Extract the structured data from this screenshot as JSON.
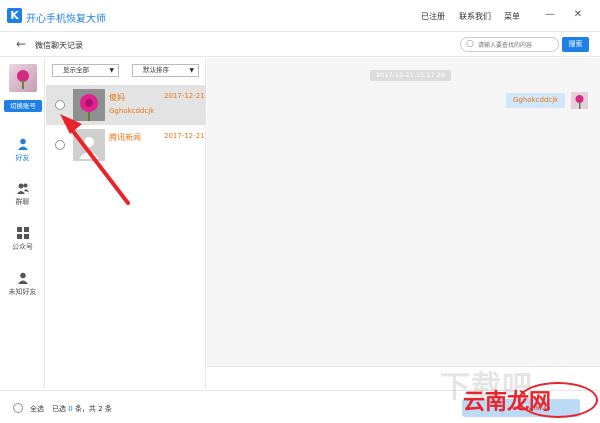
{
  "app": {
    "logo": "K",
    "title": "开心手机恢复大师"
  },
  "top_menu": {
    "register": "已注册",
    "contact": "联系我们",
    "menu": "菜单"
  },
  "window_controls": {
    "minimize": "—",
    "close": "✕"
  },
  "subbar": {
    "back": "←",
    "title": "微信聊天记录",
    "search_placeholder": "请输入要查找的内容",
    "search_button": "搜索"
  },
  "sidebar": {
    "switch_account": "切换账号",
    "nav": [
      {
        "label": "好友",
        "icon": "person-icon"
      },
      {
        "label": "群聊",
        "icon": "group-icon"
      },
      {
        "label": "公众号",
        "icon": "grid-icon"
      },
      {
        "label": "未知好友",
        "icon": "unknown-person-icon"
      }
    ]
  },
  "filters": {
    "show": "显示全部",
    "sort": "默认排序"
  },
  "contacts": [
    {
      "name": "傻妈",
      "date": "2017-12-21",
      "last_message": "Gghokcddcjk"
    },
    {
      "name": "腾讯新闻",
      "date": "2017-12-21",
      "last_message": ""
    }
  ],
  "chat": {
    "timestamp": "2017-12-21 15:17:26",
    "message": "Gghokcddcjk"
  },
  "footer": {
    "select_all": "全选",
    "selected_prefix": "已选",
    "selected_count": "0",
    "selected_mid": "条，共",
    "total_count": "2",
    "selected_suffix": "条",
    "export": "导出"
  },
  "watermark": {
    "text": "下载吧",
    "brand": "云南龙网",
    "url": "www.ynlw.cn"
  },
  "colors": {
    "accent": "#1e7fe5",
    "highlight_text": "#e77817",
    "annotation": "#e8242a"
  }
}
